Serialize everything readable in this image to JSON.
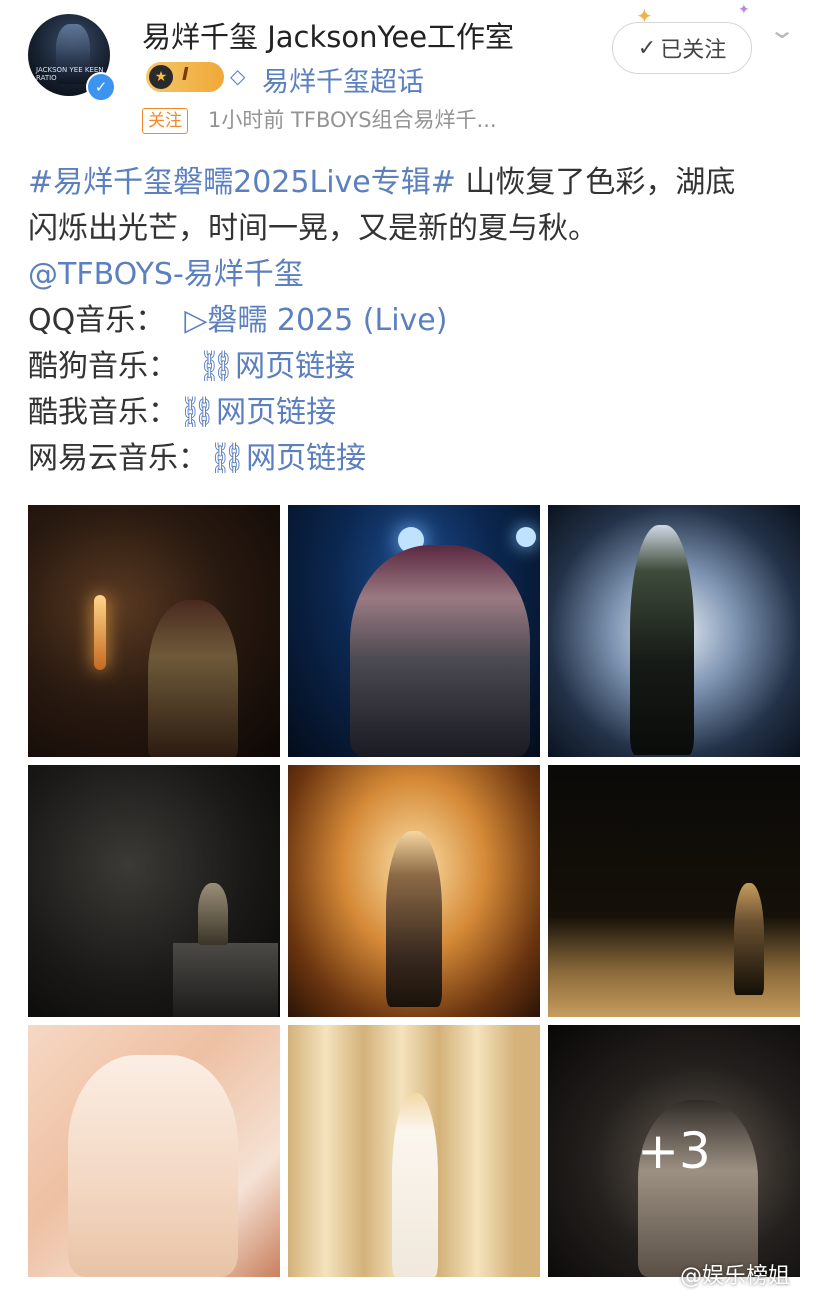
{
  "header": {
    "username": "易烊千玺 JacksonYee工作室",
    "avatar_text": "JACKSON YEE KEEN RATIO",
    "verified_icon": "verified-check-icon",
    "member_level": "I",
    "super_topic": "易烊千玺超话",
    "follow_tag": "关注",
    "meta": "1小时前  TFBOYS组合易烊千...",
    "followed_label": "已关注",
    "followed_check": "✓",
    "more_icon": "chevron-down-icon"
  },
  "post": {
    "hashtag": "#易烊千玺磐㽭2025Live专辑#",
    "text_line1_rest": " 山恢复了色彩，湖底",
    "text_line2": "闪烁出光芒，时间一晃，又是新的夏与秋。",
    "mention": "@TFBOYS-易烊千玺",
    "qq_label": "QQ音乐：",
    "qq_link": "▷磐㽭 2025 (Live)",
    "kugou_label": "酷狗音乐：",
    "kuwo_label": "酷我音乐：",
    "netease_label": "网易云音乐：",
    "web_link": "网页链接"
  },
  "gallery": {
    "more_count": "+3",
    "photos": [
      "photo-1",
      "photo-2",
      "photo-3",
      "photo-4",
      "photo-5",
      "photo-6",
      "photo-7",
      "photo-8",
      "photo-9"
    ]
  },
  "watermark": "@娱乐榜姐"
}
